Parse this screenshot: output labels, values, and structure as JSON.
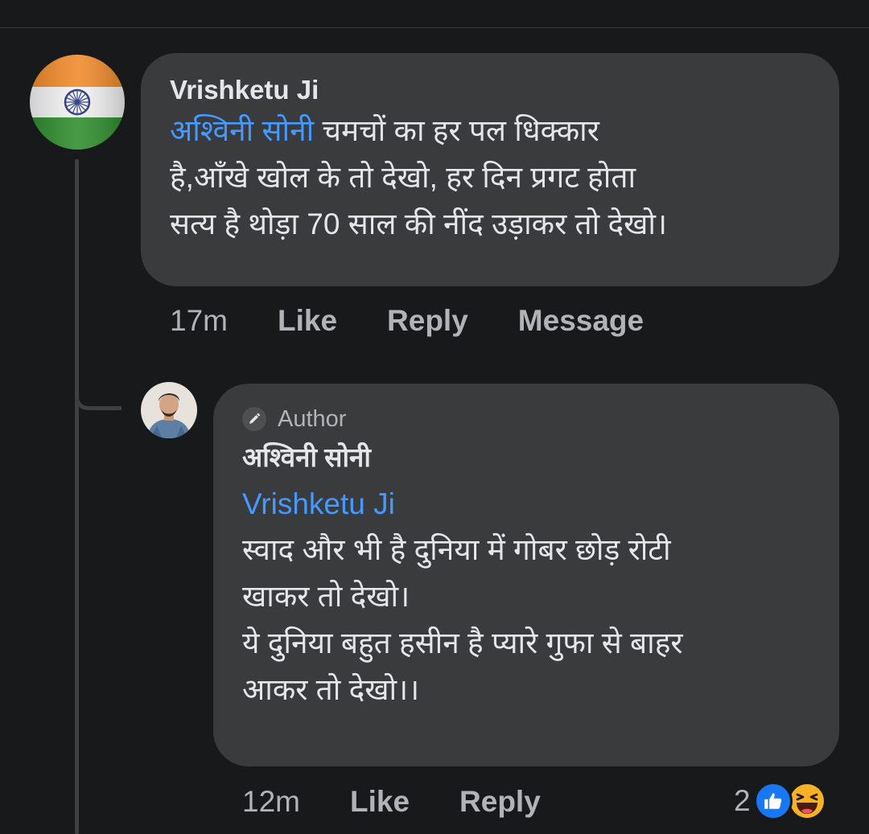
{
  "comment": {
    "author": "Vrishketu Ji",
    "mention": "अश्विनी सोनी",
    "lines": [
      " चमचों का हर पल धिक्कार",
      "है,आँखे खोल के तो देखो, हर दिन प्रगट होता",
      "सत्य है थोड़ा 70 साल की नींद उड़ाकर तो देखो।"
    ],
    "actions": {
      "time": "17m",
      "like": "Like",
      "reply": "Reply",
      "message": "Message"
    }
  },
  "reply": {
    "badge": "Author",
    "author": "अश्विनी सोनी",
    "mention": "Vrishketu Ji",
    "lines": [
      "स्वाद और भी है दुनिया में गोबर छोड़ रोटी",
      "खाकर तो देखो।",
      "ये दुनिया बहुत हसीन है प्यारे गुफा से बाहर",
      "आकर तो देखो।।"
    ],
    "actions": {
      "time": "12m",
      "like": "Like",
      "reply": "Reply"
    },
    "reactions": {
      "count": "2",
      "icons": [
        "like-icon",
        "haha-icon"
      ]
    }
  },
  "colors": {
    "background": "#18191a",
    "bubble": "#3a3b3c",
    "mention": "#4599ff",
    "text": "#e4e6eb",
    "muted": "#b0b3b8",
    "like": "#1877f2",
    "haha": "#f7b125"
  }
}
